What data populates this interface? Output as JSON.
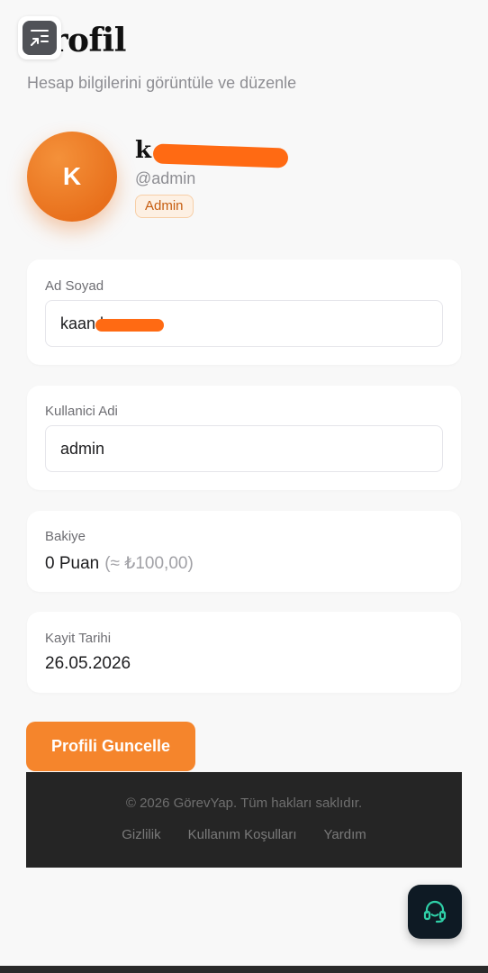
{
  "header": {
    "title": "Profil",
    "subtitle": "Hesap bilgilerini görüntüle ve düzenle"
  },
  "profile": {
    "avatar_initial": "K",
    "name_visible": "k",
    "username": "@admin",
    "role_badge": "Admin"
  },
  "fields": {
    "full_name": {
      "label": "Ad Soyad",
      "value_visible": "kaan k"
    },
    "username": {
      "label": "Kullanici Adi",
      "value": "admin"
    },
    "balance": {
      "label": "Bakiye",
      "value": "0 Puan",
      "equivalent": "(≈ ₺100,00)"
    },
    "registered": {
      "label": "Kayit Tarihi",
      "value": "26.05.2026"
    }
  },
  "actions": {
    "update_label": "Profili Guncelle"
  },
  "footer": {
    "copyright": "© 2026 GörevYap. Tüm hakları saklıdır.",
    "links": [
      "Gizlilik",
      "Kullanım Koşulları",
      "Yardım"
    ]
  },
  "icons": {
    "collapse": "collapse-arrows-icon",
    "support": "headset-support-icon"
  },
  "colors": {
    "accent": "#f5852c",
    "redaction": "#ff6a13",
    "footer_bg": "#252525",
    "support_bg": "#0e1a24"
  }
}
